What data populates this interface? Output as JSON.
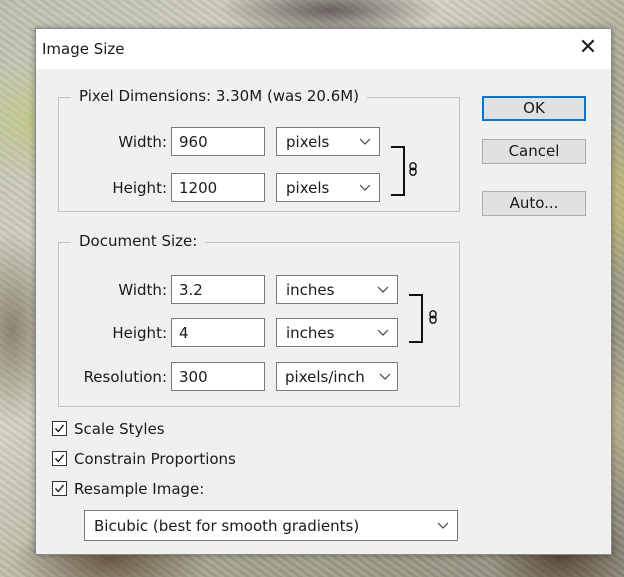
{
  "dialog": {
    "title": "Image Size",
    "close_symbol": "✕"
  },
  "pixel_dimensions": {
    "legend": "Pixel Dimensions:  3.30M (was 20.6M)",
    "width_label": "Width:",
    "width_value": "960",
    "width_unit": "pixels",
    "height_label": "Height:",
    "height_value": "1200",
    "height_unit": "pixels",
    "link_icon": "chain-link-icon"
  },
  "document_size": {
    "legend": "Document Size:",
    "width_label": "Width:",
    "width_value": "3.2",
    "width_unit": "inches",
    "height_label": "Height:",
    "height_value": "4",
    "height_unit": "inches",
    "resolution_label": "Resolution:",
    "resolution_value": "300",
    "resolution_unit": "pixels/inch",
    "link_icon": "chain-link-icon"
  },
  "buttons": {
    "ok": "OK",
    "cancel": "Cancel",
    "auto": "Auto..."
  },
  "options": {
    "scale_styles": {
      "label": "Scale Styles",
      "checked": true
    },
    "constrain_proportions": {
      "label": "Constrain Proportions",
      "checked": true
    },
    "resample_image": {
      "label": "Resample Image:",
      "checked": true
    },
    "resample_method": "Bicubic (best for smooth gradients)"
  },
  "colors": {
    "dialog_bg": "#f0f0f0",
    "default_button_border": "#0078d7"
  }
}
